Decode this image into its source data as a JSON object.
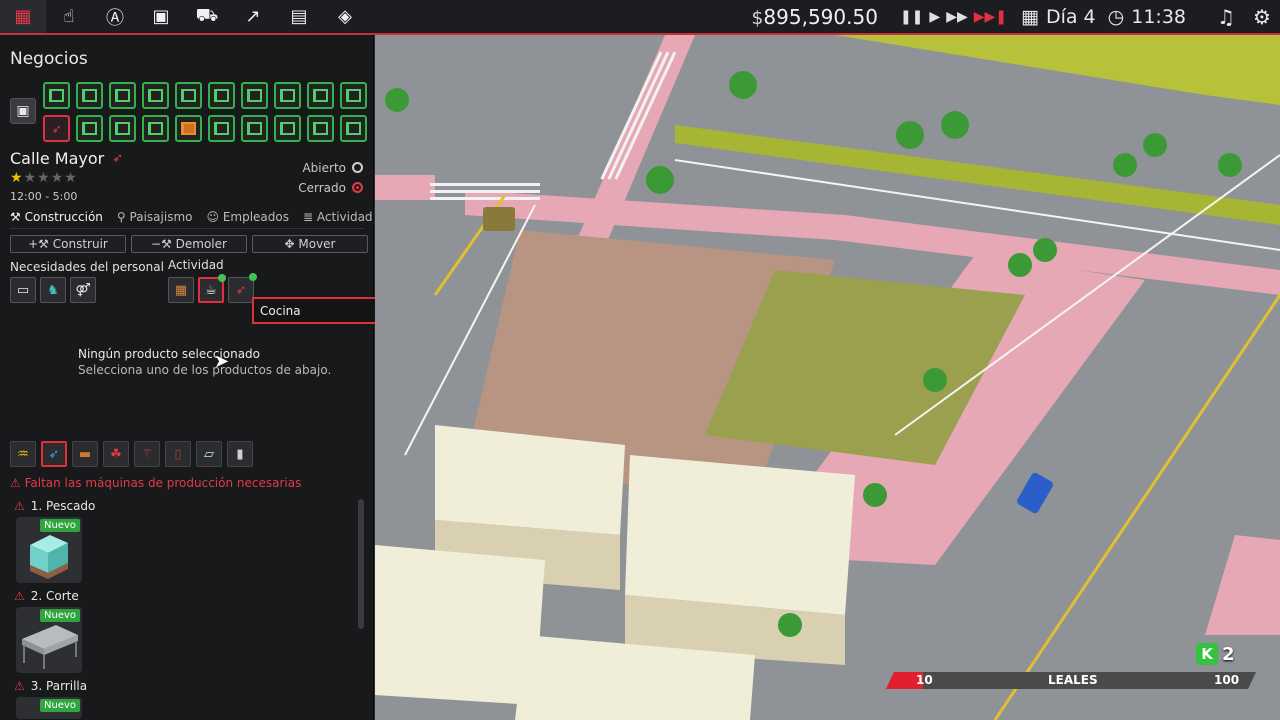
{
  "topbar": {
    "icons": [
      "menu-icon",
      "hand-money-icon",
      "typography-icon",
      "briefcase-icon",
      "truck-icon",
      "trend-chart-icon",
      "ledger-icon",
      "layers-icon"
    ],
    "money": "895,590.50",
    "currency_symbol": "$",
    "day": "Día 4",
    "time": "11:38"
  },
  "panel": {
    "title": "Negocios",
    "street": "Calle Mayor",
    "rating": 1,
    "rating_max": 5,
    "hours": "12:00 - 5:00",
    "status_open": "Abierto",
    "status_closed": "Cerrado",
    "tabs": [
      "Construcción",
      "Paisajismo",
      "Empleados",
      "Actividad"
    ],
    "actions": [
      "Construir",
      "Demoler",
      "Mover"
    ],
    "needs_label": "Necesidades del personal",
    "activity_label": "Actividad",
    "tooltip": "Cocina",
    "none_title": "Ningún producto seleccionado",
    "none_sub": "Selecciona uno de los productos de abajo.",
    "warning": "Faltan las máquinas de producción necesarias",
    "steps": [
      {
        "title": "1. Pescado",
        "badge": "Nuevo"
      },
      {
        "title": "2. Corte",
        "badge": "Nuevo"
      },
      {
        "title": "3. Parrilla",
        "badge": "Nuevo"
      }
    ]
  },
  "map": {
    "loyalty_min": "10",
    "loyalty_label": "LEALES",
    "loyalty_max": "100",
    "loyalty_level": 0.1,
    "k_count": "2"
  },
  "colors": {
    "accent": "#e0303f",
    "green": "#2fb34a",
    "road": "#8e9196",
    "sidewalk": "#e7a9b6",
    "grass": "#b9c23a"
  }
}
